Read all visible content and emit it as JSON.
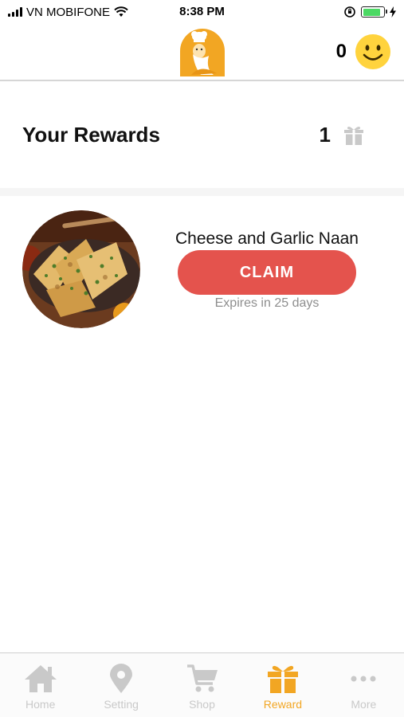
{
  "status_bar": {
    "carrier": "VN MOBIFONE",
    "time": "8:38 PM",
    "battery_level": 0.85
  },
  "header": {
    "logo_icon": "chef-logo-icon",
    "points": "0",
    "points_icon": "smiley-face-icon"
  },
  "rewards": {
    "title": "Your Rewards",
    "count": "1",
    "count_icon": "gift-icon"
  },
  "reward_items": [
    {
      "name": "Cheese and Garlic Naan",
      "claim_label": "CLAIM",
      "expires": "Expires in 25 days",
      "image": "naan-bread-photo"
    }
  ],
  "tabs": [
    {
      "label": "Home",
      "icon": "home-icon",
      "active": false
    },
    {
      "label": "Setting",
      "icon": "location-pin-icon",
      "active": false
    },
    {
      "label": "Shop",
      "icon": "cart-icon",
      "active": false
    },
    {
      "label": "Reward",
      "icon": "gift-icon",
      "active": true
    },
    {
      "label": "More",
      "icon": "more-dots-icon",
      "active": false
    }
  ],
  "colors": {
    "brand": "#f2a623",
    "claim": "#e4534d",
    "inactive": "#c9c9c9",
    "muted_text": "#8e8e8e"
  }
}
